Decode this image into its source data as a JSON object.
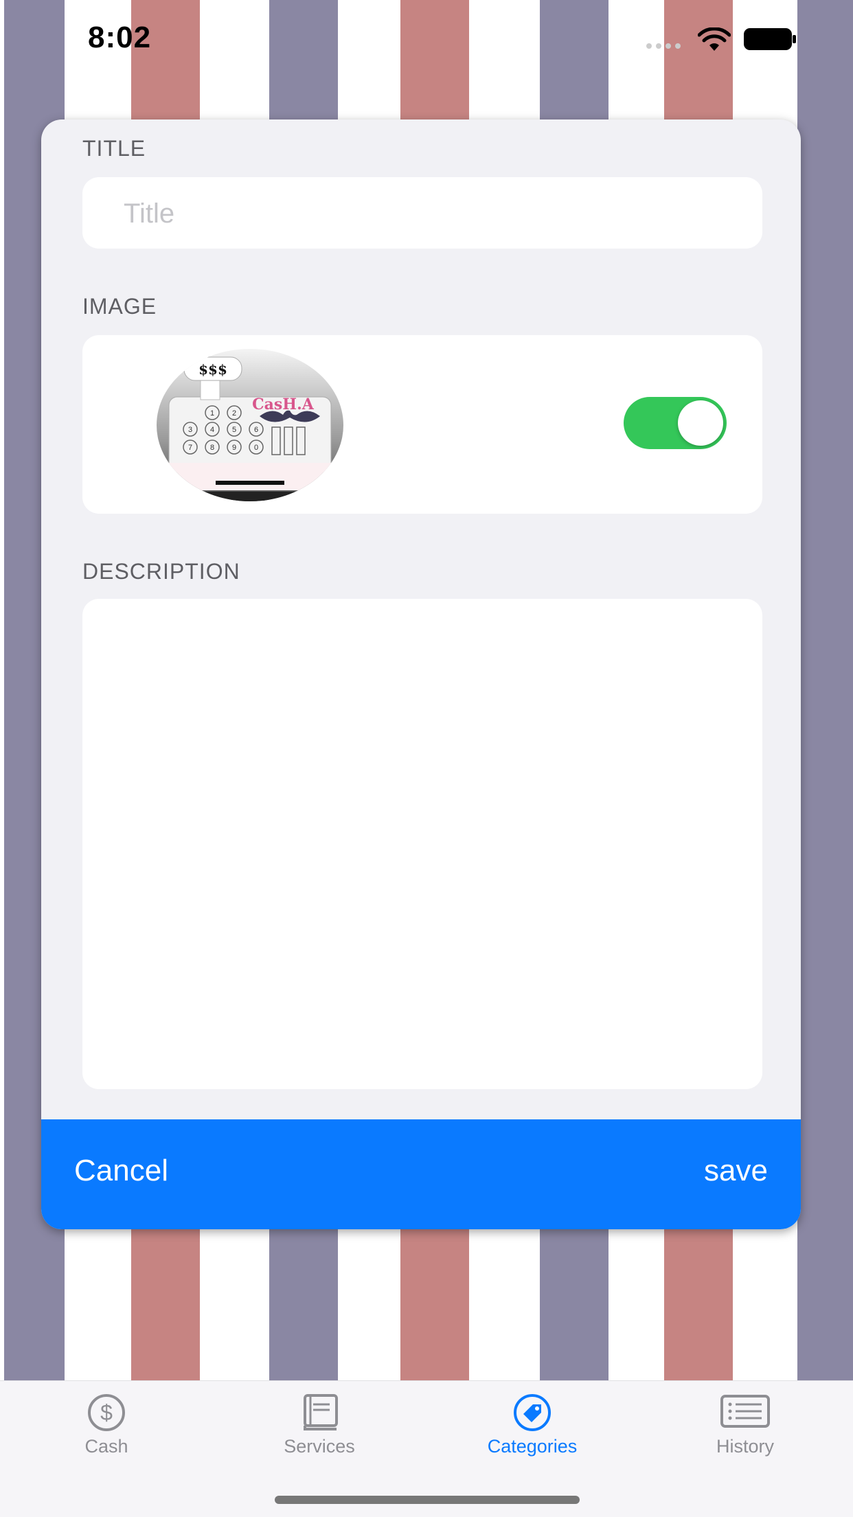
{
  "status_bar": {
    "time": "8:02"
  },
  "colors": {
    "stripe_purple": "#8a87a3",
    "stripe_red": "#c68482",
    "accent": "#0a7aff",
    "toggle_on": "#34c759"
  },
  "form": {
    "title_label": "TITLE",
    "title_placeholder": "Title",
    "title_value": "",
    "image_label": "IMAGE",
    "image_toggle_on": true,
    "logo_text": {
      "price": "$$$",
      "brand": "CasH.A"
    },
    "keypad_keys": [
      "1",
      "2",
      "3",
      "4",
      "5",
      "6",
      "7",
      "8",
      "9",
      "0"
    ],
    "description_label": "DESCRIPTION",
    "description_value": ""
  },
  "actions": {
    "cancel_label": "Cancel",
    "save_label": "save"
  },
  "tabs": [
    {
      "label": "Cash",
      "icon": "dollar-circle-icon",
      "active": false
    },
    {
      "label": "Services",
      "icon": "book-icon",
      "active": false
    },
    {
      "label": "Categories",
      "icon": "tag-icon",
      "active": true
    },
    {
      "label": "History",
      "icon": "list-icon",
      "active": false
    }
  ]
}
